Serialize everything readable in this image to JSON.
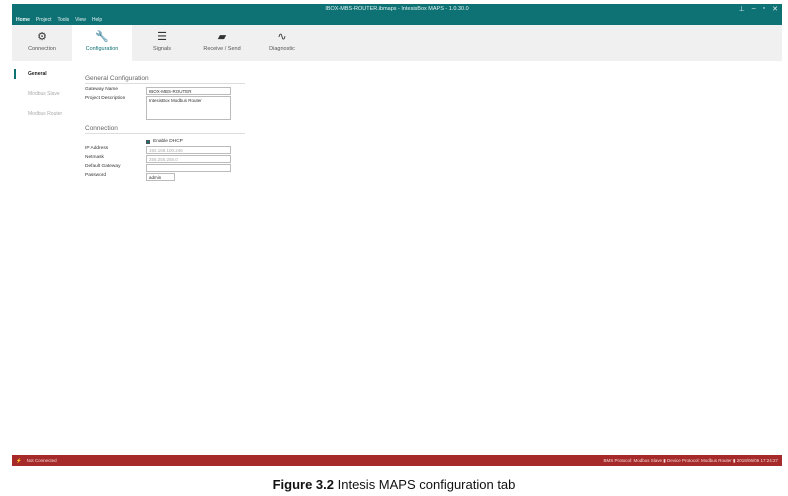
{
  "window": {
    "title": "IBOX-MBS-ROUTER.ibmaps - IntesisBox MAPS - 1.0.30.0",
    "controls": [
      "⊥",
      "–",
      "▫",
      "✕"
    ]
  },
  "menu": [
    "Home",
    "Project",
    "Tools",
    "View",
    "Help"
  ],
  "ribbon": [
    {
      "label": "Connection",
      "icon": "⚙"
    },
    {
      "label": "Configuration",
      "icon": "🔧"
    },
    {
      "label": "Signals",
      "icon": "☰"
    },
    {
      "label": "Receive / Send",
      "icon": "▰"
    },
    {
      "label": "Diagnostic",
      "icon": "∿"
    }
  ],
  "sidebar": [
    "General",
    "Modbus Slave",
    "Modbus Router"
  ],
  "general": {
    "title": "General Configuration",
    "gateway_name_label": "Gateway Name",
    "gateway_name": "IBOX-MBS-ROUTER",
    "project_desc_label": "Project Description",
    "project_desc": "IntesisBox Modbus Router"
  },
  "connection": {
    "title": "Connection",
    "dhcp_label": "Enable DHCP",
    "ip_label": "IP Address",
    "ip": "192.168.100.246",
    "netmask_label": "Netmask",
    "netmask": "255.255.255.0",
    "gateway_label": "Default Gateway",
    "gateway": "",
    "password_label": "Password",
    "password": "admin"
  },
  "status": {
    "icon": "⚡",
    "left": "Not Connected",
    "right": "BMS Protocol: Modbus Slave  ▮  Device Protocol: Modbus Router  ▮  2018/06/06 17:24:27"
  },
  "caption": {
    "bold": "Figure 3.2",
    "text": " Intesis MAPS configuration tab"
  },
  "colors": {
    "accent": "#0e7173",
    "status": "#a72a2a"
  }
}
